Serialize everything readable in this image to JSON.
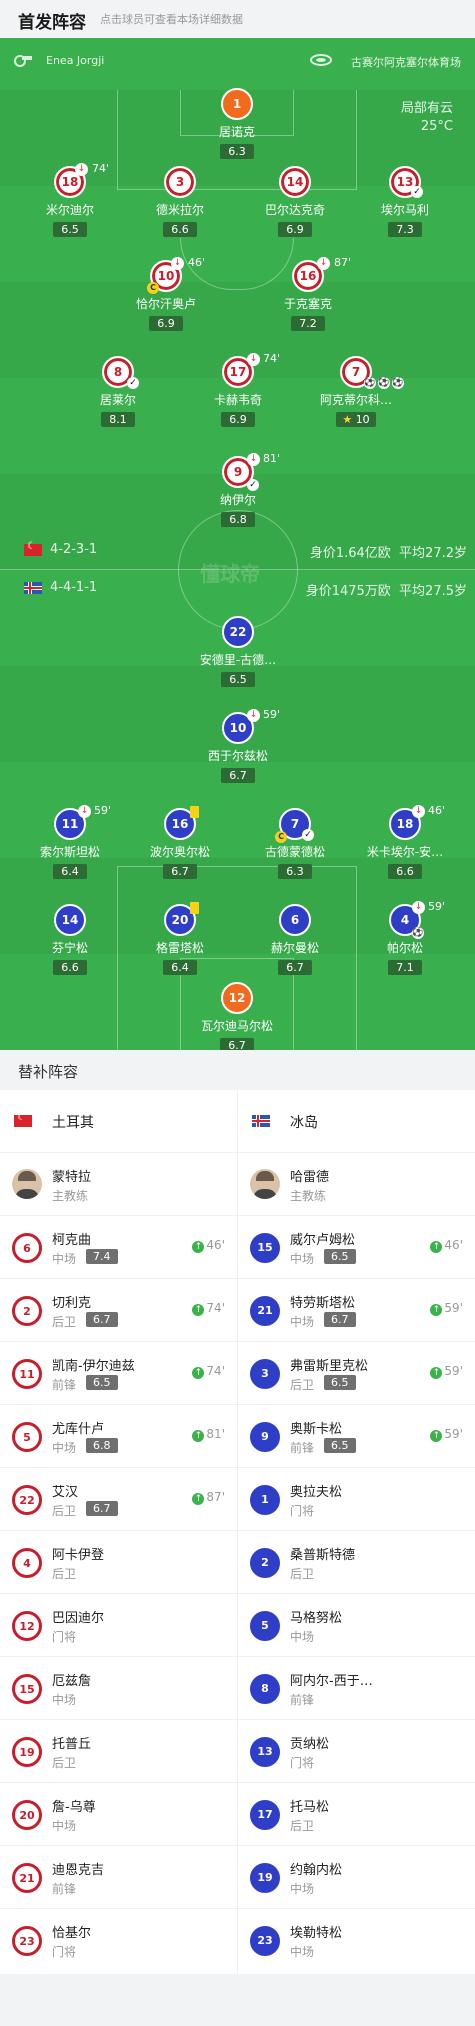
{
  "header": {
    "title": "首发阵容",
    "subtitle": "点击球员可查看本场详细数据"
  },
  "match_info": {
    "referee": "Enea Jorgji",
    "venue": "古赛尔阿克塞尔体育场",
    "weather": "局部有云",
    "temperature": "25°C"
  },
  "watermark": "懂球帝",
  "home_team": {
    "name": "土耳其",
    "formation": "4-2-3-1",
    "value": "身价1.64亿欧",
    "avg_age": "平均27.2岁",
    "color": "#c81e2b"
  },
  "away_team": {
    "name": "冰岛",
    "formation": "4-4-1-1",
    "value": "身价1475万欧",
    "avg_age": "平均27.5岁",
    "color": "#2f3ec7"
  },
  "home_lineup": [
    {
      "number": "1",
      "name": "居诺克",
      "rating": "6.3"
    },
    {
      "number": "18",
      "name": "米尔迪尔",
      "rating": "6.5",
      "sub_minute": "74'"
    },
    {
      "number": "3",
      "name": "德米拉尔",
      "rating": "6.6"
    },
    {
      "number": "14",
      "name": "巴尔达克奇",
      "rating": "6.9"
    },
    {
      "number": "13",
      "name": "埃尔马利",
      "rating": "7.3"
    },
    {
      "number": "10",
      "name": "恰尔汗奥卢",
      "rating": "6.9",
      "sub_minute": "46'"
    },
    {
      "number": "16",
      "name": "于克塞克",
      "rating": "7.2",
      "sub_minute": "87'"
    },
    {
      "number": "8",
      "name": "居莱尔",
      "rating": "8.1"
    },
    {
      "number": "17",
      "name": "卡赫韦奇",
      "rating": "6.9",
      "sub_minute": "74'"
    },
    {
      "number": "7",
      "name": "阿克蒂尔科…",
      "rating": "10"
    },
    {
      "number": "9",
      "name": "纳伊尔",
      "rating": "6.8",
      "sub_minute": "81'"
    }
  ],
  "away_lineup": [
    {
      "number": "22",
      "name": "安德里-古德…",
      "rating": "6.5"
    },
    {
      "number": "10",
      "name": "西于尔兹松",
      "rating": "6.7",
      "sub_minute": "59'"
    },
    {
      "number": "11",
      "name": "索尔斯坦松",
      "rating": "6.4",
      "sub_minute": "59'"
    },
    {
      "number": "16",
      "name": "波尔奥尔松",
      "rating": "6.7"
    },
    {
      "number": "7",
      "name": "古德蒙德松",
      "rating": "6.3"
    },
    {
      "number": "18",
      "name": "米卡埃尔-安…",
      "rating": "6.6",
      "sub_minute": "46'"
    },
    {
      "number": "14",
      "name": "芬宁松",
      "rating": "6.6"
    },
    {
      "number": "20",
      "name": "格雷塔松",
      "rating": "6.4"
    },
    {
      "number": "6",
      "name": "赫尔曼松",
      "rating": "6.7"
    },
    {
      "number": "4",
      "name": "帕尔松",
      "rating": "7.1",
      "sub_minute": "59'"
    },
    {
      "number": "12",
      "name": "瓦尔迪马尔松",
      "rating": "6.7"
    }
  ],
  "subs_title": "替补阵容",
  "home_subs": [
    {
      "name": "蒙特拉",
      "position": "主教练",
      "coach": true
    },
    {
      "number": "6",
      "name": "柯克曲",
      "position": "中场",
      "rating": "7.4",
      "in": "46'"
    },
    {
      "number": "2",
      "name": "切利克",
      "position": "后卫",
      "rating": "6.7",
      "in": "74'"
    },
    {
      "number": "11",
      "name": "凯南-伊尔迪兹",
      "position": "前锋",
      "rating": "6.5",
      "in": "74'"
    },
    {
      "number": "5",
      "name": "尤库什卢",
      "position": "中场",
      "rating": "6.8",
      "in": "81'"
    },
    {
      "number": "22",
      "name": "艾汉",
      "position": "后卫",
      "rating": "6.7",
      "in": "87'"
    },
    {
      "number": "4",
      "name": "阿卡伊登",
      "position": "后卫"
    },
    {
      "number": "12",
      "name": "巴因迪尔",
      "position": "门将"
    },
    {
      "number": "15",
      "name": "厄兹詹",
      "position": "中场"
    },
    {
      "number": "19",
      "name": "托普丘",
      "position": "后卫"
    },
    {
      "number": "20",
      "name": "詹-乌尊",
      "position": "中场"
    },
    {
      "number": "21",
      "name": "迪恩克吉",
      "position": "前锋"
    },
    {
      "number": "23",
      "name": "恰基尔",
      "position": "门将"
    }
  ],
  "away_subs": [
    {
      "name": "哈雷德",
      "position": "主教练",
      "coach": true
    },
    {
      "number": "15",
      "name": "威尔卢姆松",
      "position": "中场",
      "rating": "6.5",
      "in": "46'"
    },
    {
      "number": "21",
      "name": "特劳斯塔松",
      "position": "中场",
      "rating": "6.7",
      "in": "59'"
    },
    {
      "number": "3",
      "name": "弗雷斯里克松",
      "position": "后卫",
      "rating": "6.5",
      "in": "59'"
    },
    {
      "number": "9",
      "name": "奥斯卡松",
      "position": "前锋",
      "rating": "6.5",
      "in": "59'"
    },
    {
      "number": "1",
      "name": "奥拉夫松",
      "position": "门将"
    },
    {
      "number": "2",
      "name": "桑普斯特德",
      "position": "后卫"
    },
    {
      "number": "5",
      "name": "马格努松",
      "position": "中场"
    },
    {
      "number": "8",
      "name": "阿内尔-西于…",
      "position": "前锋"
    },
    {
      "number": "13",
      "name": "贡纳松",
      "position": "门将"
    },
    {
      "number": "17",
      "name": "托马松",
      "position": "后卫"
    },
    {
      "number": "19",
      "name": "约翰内松",
      "position": "中场"
    },
    {
      "number": "23",
      "name": "埃勒特松",
      "position": "中场"
    }
  ]
}
